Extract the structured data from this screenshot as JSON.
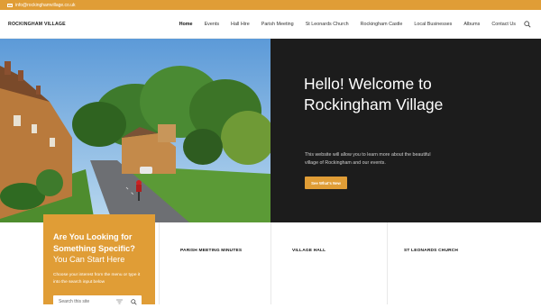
{
  "topbar": {
    "email": "info@rockinghamvillage.co.uk"
  },
  "header": {
    "brand": "ROCKINGHAM VILLAGE",
    "nav": [
      "Home",
      "Events",
      "Hall Hire",
      "Parish Meeting",
      "St Leonards Church",
      "Rockingham Castle",
      "Local Businesses",
      "Albums",
      "Contact Us"
    ]
  },
  "hero": {
    "title": "Hello! Welcome to Rockingham Village",
    "text": "This website will allow you to learn more about the beautiful village of Rockingham and our events.",
    "button": "See What's New"
  },
  "search_card": {
    "title": "Are You Looking for Something Specific?",
    "subtitle": "You Can Start Here",
    "description": "Choose your interest from the menu or type it into the search input below",
    "placeholder": "Search this site"
  },
  "sections": [
    "PARISH MEETING MINUTES",
    "VILLAGE HALL",
    "ST LEONARDS CHURCH"
  ],
  "colors": {
    "accent": "#e09d36",
    "dark": "#1c1c1c"
  }
}
